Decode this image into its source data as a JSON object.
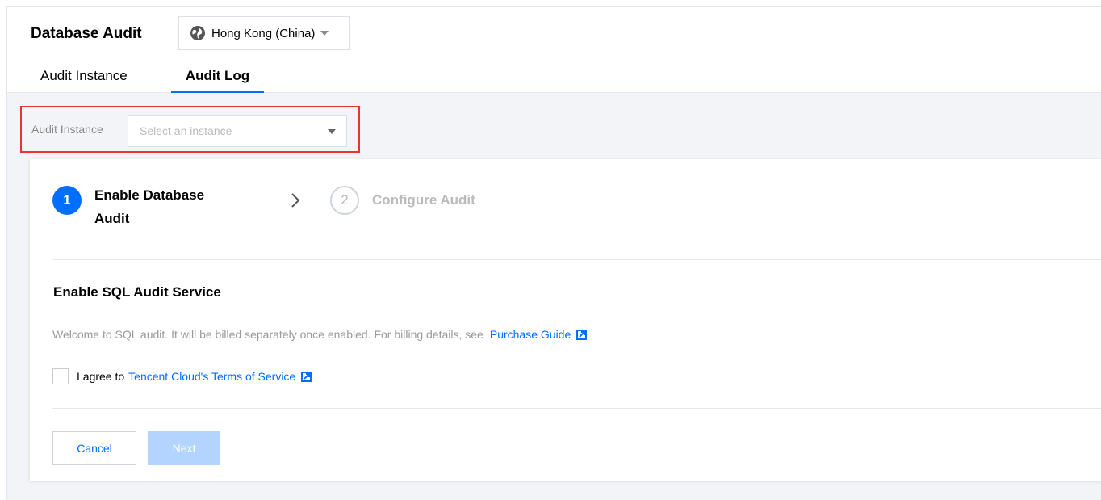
{
  "header": {
    "title": "Database Audit",
    "region": {
      "label": "Hong Kong (China)",
      "icon": "globe-icon"
    }
  },
  "tabs": [
    {
      "label": "Audit Instance",
      "active": false
    },
    {
      "label": "Audit Log",
      "active": true
    }
  ],
  "filter": {
    "label": "Audit Instance",
    "placeholder": "Select an instance",
    "highlight_color": "#e8332e"
  },
  "steps": [
    {
      "number": "1",
      "label": "Enable Database Audit",
      "active": true
    },
    {
      "number": "2",
      "label": "Configure Audit",
      "active": false
    }
  ],
  "section": {
    "title": "Enable SQL Audit Service",
    "description": "Welcome to SQL audit. It will be billed separately once enabled. For billing details, see",
    "purchase_link": "Purchase Guide",
    "agree_prefix": "I agree to",
    "terms_link": "Tencent Cloud's Terms of Service",
    "agree_checked": false
  },
  "buttons": {
    "cancel": "Cancel",
    "next": "Next"
  },
  "colors": {
    "accent": "#006eff",
    "disabled_button": "#b3d4ff"
  }
}
